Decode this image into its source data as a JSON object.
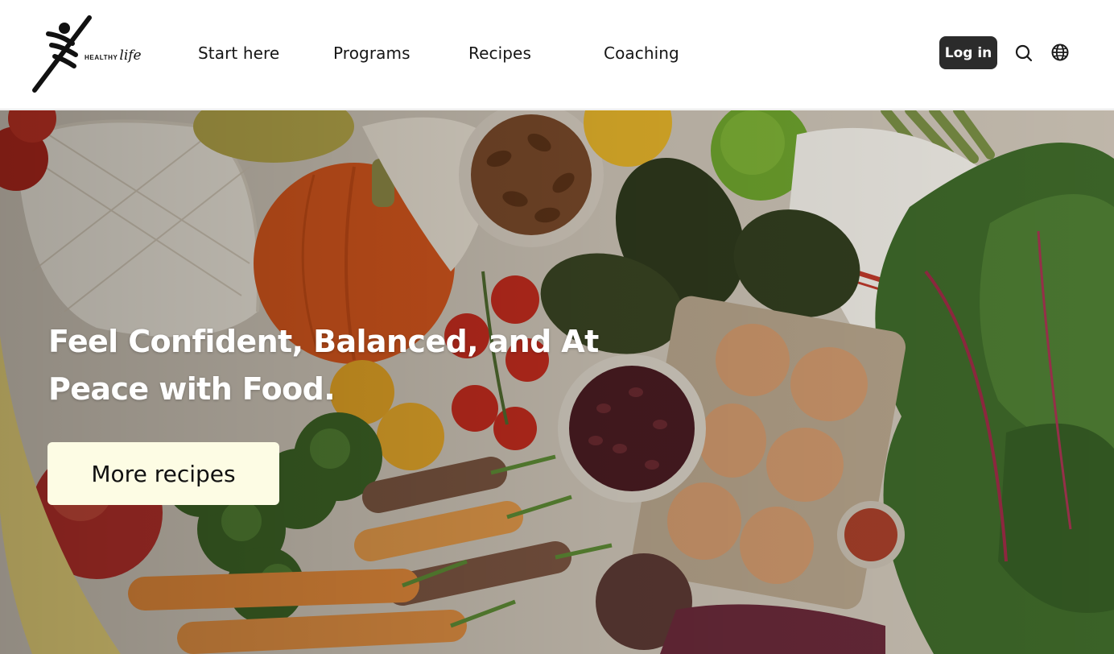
{
  "brand": {
    "healthy": "HEALTHY",
    "life": "life"
  },
  "nav": {
    "items": [
      {
        "label": "Start here"
      },
      {
        "label": "Programs"
      },
      {
        "label": "Recipes"
      },
      {
        "label": "Coaching"
      }
    ],
    "login_label": "Log in",
    "search_icon": "search-icon",
    "globe_icon": "globe-icon"
  },
  "hero": {
    "title": "Feel Confident, Balanced, and At Peace with Food.",
    "cta_label": "More recipes",
    "background": "photo of fresh groceries: squash, avocados, eggs, beans, pecans, carrots, broccoli, leafy greens"
  },
  "colors": {
    "login_bg": "#2b2b2b",
    "cta_bg": "#fdfce4",
    "header_bg": "#ffffff",
    "hero_text": "#ffffff"
  }
}
